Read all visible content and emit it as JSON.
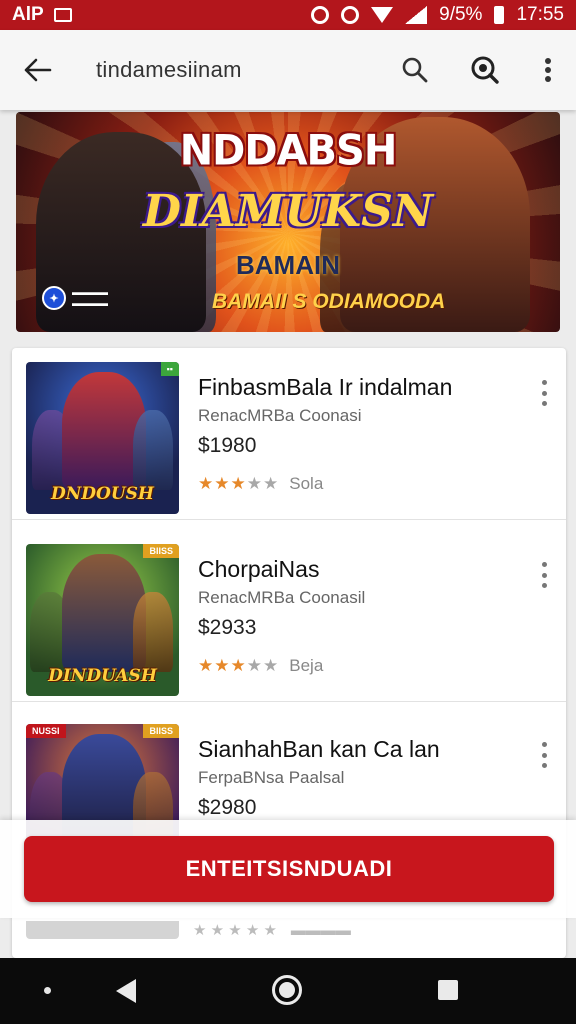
{
  "colors": {
    "accent": "#c8161d",
    "statusbar": "#b3161c",
    "star_on": "#e6882a",
    "star_off": "#a8a8a8"
  },
  "status_bar": {
    "left_text": "AlP",
    "battery": "9/5%",
    "time": "17:55"
  },
  "app_bar": {
    "title": "tindamesiinam",
    "icons": [
      "back-arrow-icon",
      "search-icon",
      "zoom-icon",
      "more-vert-icon"
    ]
  },
  "banner": {
    "title": "NDDABSH",
    "logo": "DIAMUKSN",
    "subtitle": "BAMAIN",
    "tagline": "BAMAII S ODIAMOODA"
  },
  "games": [
    {
      "title": "FinbasmBala Ir indalman",
      "developer": "RenacMRBa Coonasi",
      "price": "$1980",
      "rating": 3,
      "rating_label": "Sola",
      "thumb_logo": "DNDOUSH"
    },
    {
      "title": "ChorpaiNas",
      "developer": "RenacMRBa Coonasil",
      "price": "$2933",
      "rating": 3,
      "rating_label": "Beja",
      "thumb_logo": "DINDUASH",
      "thumb_tag": "BIISS"
    },
    {
      "title": "SianhahBan kan Ca lan",
      "developer": "FerpaBNsa Paalsal",
      "price": "$2980",
      "rating": 0,
      "rating_label": "",
      "thumb_tag": "BIISS",
      "thumb_tag_left": "NUSSI"
    }
  ],
  "cta": {
    "label": "ENTEITSISNDUADI"
  }
}
